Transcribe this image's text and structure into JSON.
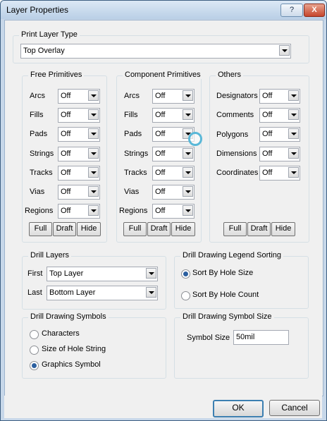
{
  "window": {
    "title": "Layer Properties",
    "help_label": "?",
    "close_label": "X"
  },
  "print_layer_type": {
    "label": "Print Layer Type",
    "value": "Top Overlay"
  },
  "free_primitives": {
    "label": "Free Primitives",
    "rows": [
      {
        "label": "Arcs",
        "value": "Off"
      },
      {
        "label": "Fills",
        "value": "Off"
      },
      {
        "label": "Pads",
        "value": "Off"
      },
      {
        "label": "Strings",
        "value": "Off"
      },
      {
        "label": "Tracks",
        "value": "Off"
      },
      {
        "label": "Vias",
        "value": "Off"
      },
      {
        "label": "Regions",
        "value": "Off"
      }
    ],
    "buttons": [
      "Full",
      "Draft",
      "Hide"
    ]
  },
  "component_primitives": {
    "label": "Component Primitives",
    "rows": [
      {
        "label": "Arcs",
        "value": "Off"
      },
      {
        "label": "Fills",
        "value": "Off"
      },
      {
        "label": "Pads",
        "value": "Off"
      },
      {
        "label": "Strings",
        "value": "Off"
      },
      {
        "label": "Tracks",
        "value": "Off"
      },
      {
        "label": "Vias",
        "value": "Off"
      },
      {
        "label": "Regions",
        "value": "Off"
      }
    ],
    "buttons": [
      "Full",
      "Draft",
      "Hide"
    ]
  },
  "others": {
    "label": "Others",
    "rows": [
      {
        "label": "Designators",
        "value": "Off"
      },
      {
        "label": "Comments",
        "value": "Off"
      },
      {
        "label": "Polygons",
        "value": "Off"
      },
      {
        "label": "Dimensions",
        "value": "Off"
      },
      {
        "label": "Coordinates",
        "value": "Off"
      }
    ],
    "buttons": [
      "Full",
      "Draft",
      "Hide"
    ]
  },
  "drill_layers": {
    "label": "Drill Layers",
    "first_label": "First",
    "first_value": "Top Layer",
    "last_label": "Last",
    "last_value": "Bottom Layer"
  },
  "legend_sorting": {
    "label": "Drill Drawing Legend Sorting",
    "options": [
      {
        "label": "Sort By Hole Size",
        "checked": true
      },
      {
        "label": "Sort By Hole Count",
        "checked": false
      }
    ]
  },
  "drill_symbols": {
    "label": "Drill Drawing Symbols",
    "options": [
      {
        "label": "Characters",
        "checked": false
      },
      {
        "label": "Size of Hole String",
        "checked": false
      },
      {
        "label": "Graphics Symbol",
        "checked": true
      }
    ]
  },
  "symbol_size": {
    "label": "Drill Drawing Symbol Size",
    "field_label": "Symbol Size",
    "value": "50mil"
  },
  "dialog_buttons": {
    "ok": "OK",
    "cancel": "Cancel"
  },
  "colors": {
    "title_bar": "#c7d7e9",
    "close_button": "#c6462d",
    "radio_accent": "#2b5f9f"
  }
}
